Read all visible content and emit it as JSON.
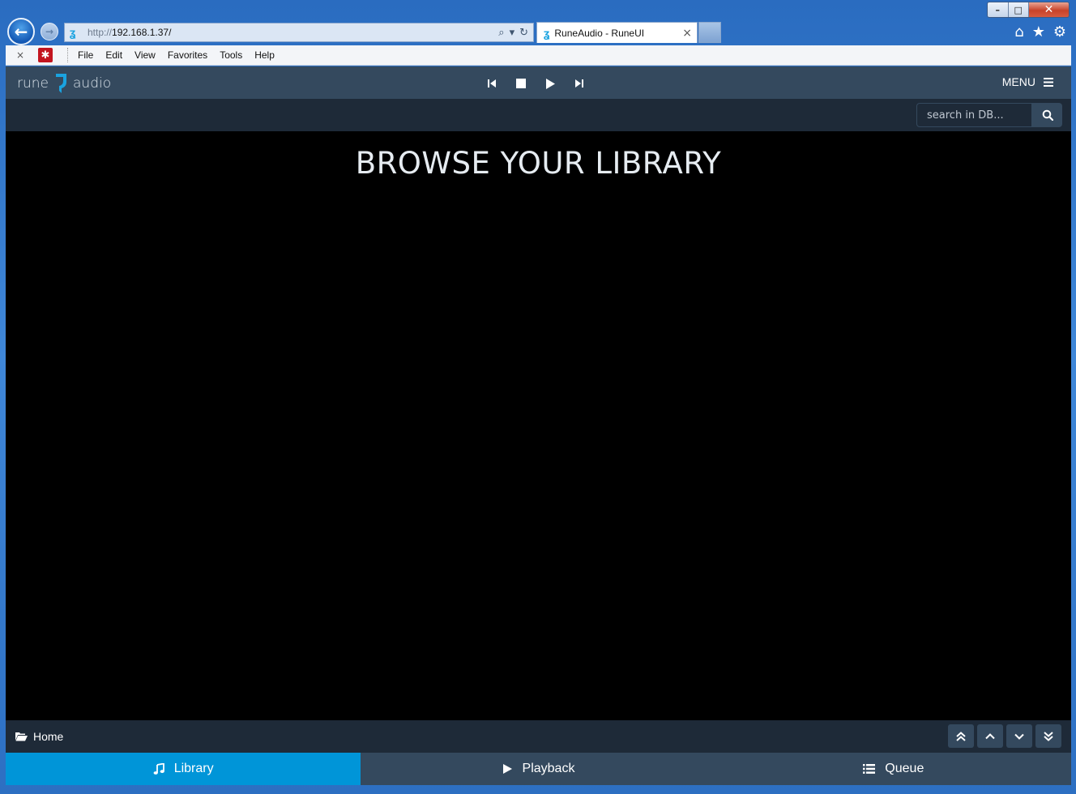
{
  "browser": {
    "url_protocol": "http://",
    "url_host": "192.168.1.37/",
    "tab_title": "RuneAudio - RuneUI",
    "tab_close": "×",
    "menu": [
      "File",
      "Edit",
      "View",
      "Favorites",
      "Tools",
      "Help"
    ],
    "menubar_close": "×"
  },
  "app": {
    "logo_left": "rune",
    "logo_right": "audio",
    "menu_label": "MENU",
    "accent_color": "#0095d8",
    "bar_color": "#34495e"
  },
  "search": {
    "placeholder": "search in DB..."
  },
  "main": {
    "title": "BROWSE YOUR LIBRARY"
  },
  "breadcrumb": {
    "home": "Home"
  },
  "tabs": [
    {
      "label": "Library",
      "icon": "music-icon",
      "active": true
    },
    {
      "label": "Playback",
      "icon": "play-icon",
      "active": false
    },
    {
      "label": "Queue",
      "icon": "list-icon",
      "active": false
    }
  ]
}
